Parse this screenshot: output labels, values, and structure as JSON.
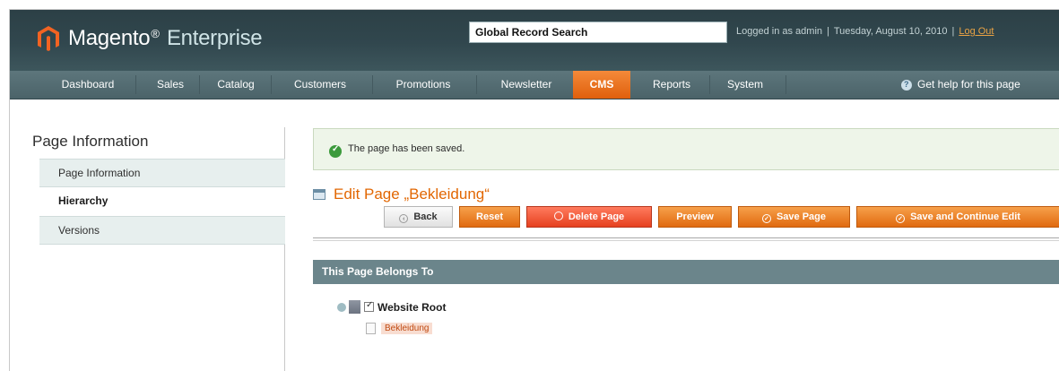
{
  "header": {
    "logo_brand": "Magento",
    "logo_mark": "®",
    "logo_product": "Enterprise",
    "search_value": "Global Record Search",
    "logged_in": "Logged in as admin",
    "date": "Tuesday, August 10, 2010",
    "logout": "Log Out",
    "logo_icon": "magento-logo-icon"
  },
  "nav": {
    "items": [
      "Dashboard",
      "Sales",
      "Catalog",
      "Customers",
      "Promotions",
      "Newsletter",
      "CMS",
      "Reports",
      "System"
    ],
    "active": "CMS",
    "help": "Get help for this page"
  },
  "sidebar": {
    "title": "Page Information",
    "tabs": [
      {
        "label": "Page Information",
        "active": false
      },
      {
        "label": "Hierarchy",
        "active": true
      },
      {
        "label": "Versions",
        "active": false
      }
    ]
  },
  "main": {
    "message": "The page has been saved.",
    "title": "Edit Page „Bekleidung“",
    "buttons": {
      "back": "Back",
      "reset": "Reset",
      "delete": "Delete Page",
      "preview": "Preview",
      "save": "Save Page",
      "save_continue": "Save and Continue Edit"
    },
    "box_title": "This Page Belongs To",
    "tree": {
      "root": "Website Root",
      "child": "Bekleidung"
    }
  },
  "colors": {
    "header_bg": "#2c4046",
    "nav_bg": "#566f75",
    "accent_orange": "#e26703",
    "active_tab_bg": "#e7efee"
  }
}
